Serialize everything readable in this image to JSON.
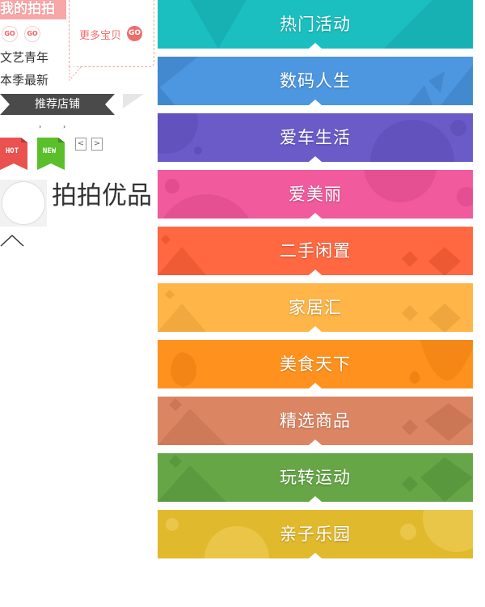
{
  "sidebar": {
    "my_pai_title": "我的拍拍",
    "go_label": "GO",
    "more_items_label": "更多宝贝",
    "links": [
      "文艺青年",
      "本季最新"
    ],
    "recommend_shops_label": "推荐店铺",
    "hot_badge": "HOT",
    "new_badge": "NEW",
    "prev_label": "<",
    "next_label": ">",
    "youpin_title": "拍拍优品",
    "colors": {
      "pink_accent": "#f06b6b",
      "banner_dark": "#4a4a4a",
      "hot_red": "#e9524f",
      "new_green": "#5bbf2c"
    }
  },
  "categories": [
    {
      "label": "热门活动",
      "color": "#1bbfc0",
      "deco": "#17a9aa"
    },
    {
      "label": "数码人生",
      "color": "#4d97e0",
      "deco": "#3f83c9"
    },
    {
      "label": "爱车生活",
      "color": "#6b5bc8",
      "deco": "#5c4db5"
    },
    {
      "label": "爱美丽",
      "color": "#f15a9d",
      "deco": "#dd4a8a"
    },
    {
      "label": "二手闲置",
      "color": "#ff6841",
      "deco": "#e8552f"
    },
    {
      "label": "家居汇",
      "color": "#ffb547",
      "deco": "#eba23a"
    },
    {
      "label": "美食天下",
      "color": "#ff921e",
      "deco": "#ee8012"
    },
    {
      "label": "精选商品",
      "color": "#dc8562",
      "deco": "#c77354"
    },
    {
      "label": "玩转运动",
      "color": "#66a646",
      "deco": "#57953b"
    },
    {
      "label": "亲子乐园",
      "color": "#e1b92d",
      "deco": "#ebc94f"
    }
  ]
}
